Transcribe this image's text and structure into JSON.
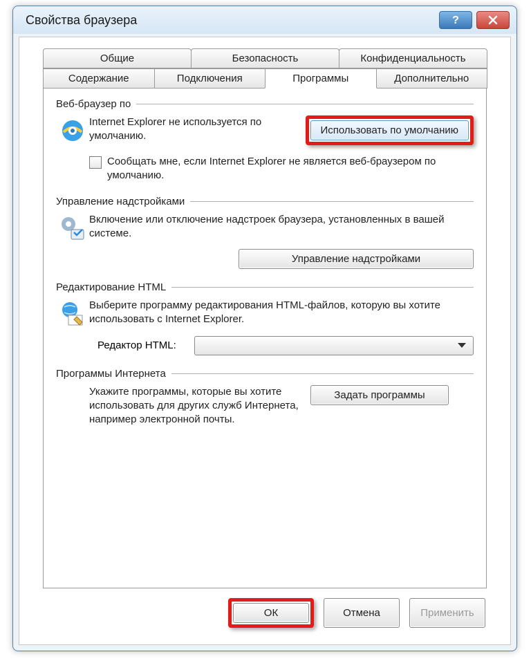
{
  "window": {
    "title": "Свойства браузера"
  },
  "tabs": {
    "row1": [
      "Общие",
      "Безопасность",
      "Конфиденциальность"
    ],
    "row2": [
      "Содержание",
      "Подключения",
      "Программы",
      "Дополнительно"
    ],
    "active": "Программы"
  },
  "groups": {
    "browser": {
      "title": "Веб-браузер по",
      "status": "Internet Explorer не используется по умолчанию.",
      "set_default_btn": "Использовать по умолчанию",
      "notify_label": "Сообщать мне, если Internet Explorer не является веб-браузером по умолчанию.",
      "notify_checked": false
    },
    "addons": {
      "title": "Управление надстройками",
      "desc": "Включение или отключение надстроек браузера, установленных в вашей системе.",
      "manage_btn": "Управление надстройками"
    },
    "html_edit": {
      "title": "Редактирование HTML",
      "desc": "Выберите программу редактирования HTML-файлов, которую вы хотите использовать с Internet Explorer.",
      "editor_label": "Редактор HTML:",
      "editor_value": ""
    },
    "internet_programs": {
      "title": "Программы Интернета",
      "desc": "Укажите программы, которые вы хотите использовать для других служб Интернета, например электронной почты.",
      "set_btn": "Задать программы"
    }
  },
  "footer": {
    "ok": "ОК",
    "cancel": "Отмена",
    "apply": "Применить"
  }
}
